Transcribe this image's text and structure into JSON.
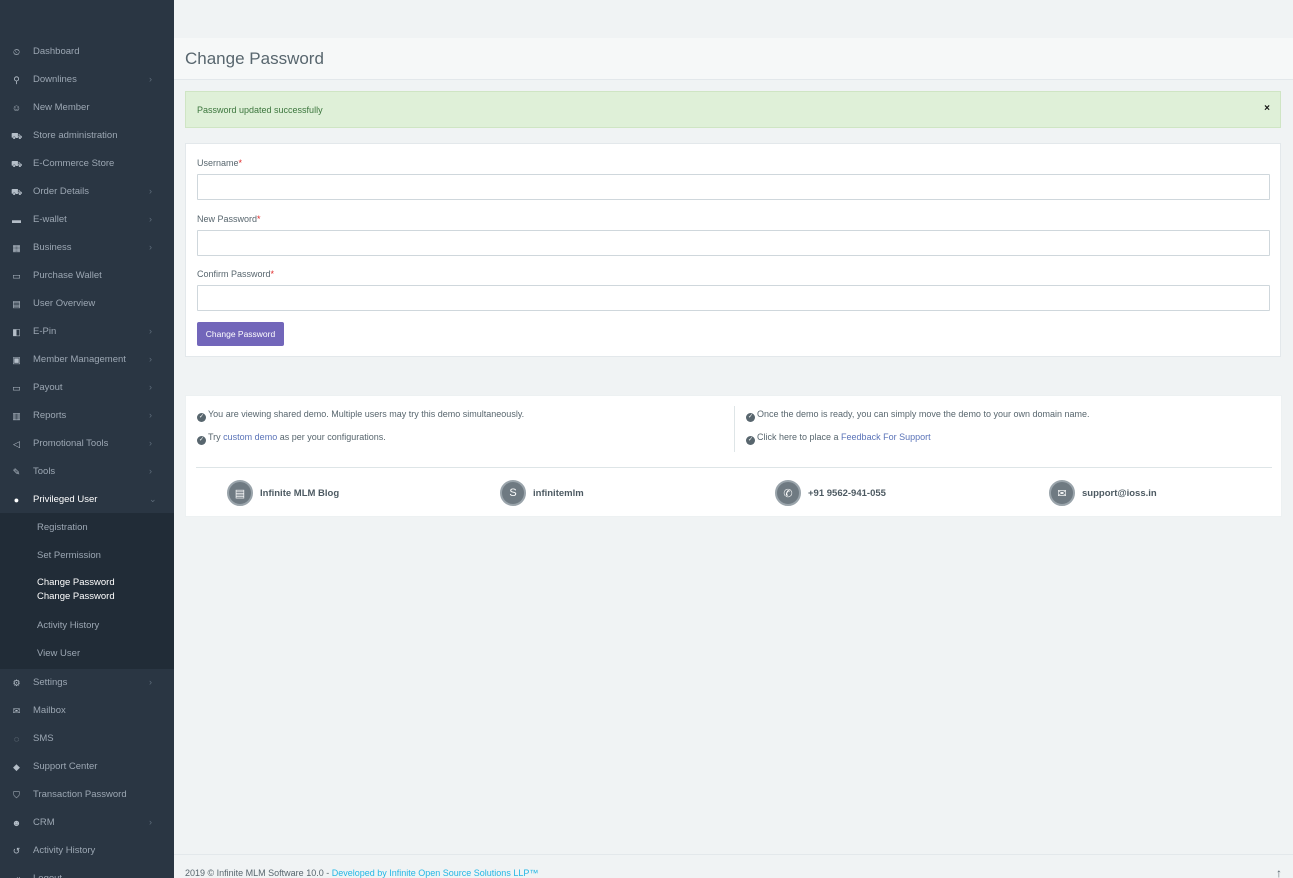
{
  "sidebar": {
    "items": [
      {
        "label": "Dashboard",
        "icon": "dashboard-icon",
        "glyph": "⏲",
        "chevron": false
      },
      {
        "label": "Downlines",
        "icon": "sitemap-icon",
        "glyph": "⚲",
        "chevron": true
      },
      {
        "label": "New Member",
        "icon": "user-plus-icon",
        "glyph": "☺",
        "chevron": false
      },
      {
        "label": "Store administration",
        "icon": "cart-arrow-icon",
        "glyph": "⛟",
        "chevron": false
      },
      {
        "label": "E-Commerce Store",
        "icon": "shopping-cart-icon",
        "glyph": "⛟",
        "chevron": false
      },
      {
        "label": "Order Details",
        "icon": "shopping-cart-icon",
        "glyph": "⛟",
        "chevron": true
      },
      {
        "label": "E-wallet",
        "icon": "briefcase-icon",
        "glyph": "▬",
        "chevron": true
      },
      {
        "label": "Business",
        "icon": "building-icon",
        "glyph": "▦",
        "chevron": true
      },
      {
        "label": "Purchase Wallet",
        "icon": "wallet-icon",
        "glyph": "▭",
        "chevron": false
      },
      {
        "label": "User Overview",
        "icon": "id-card-icon",
        "glyph": "▤",
        "chevron": false
      },
      {
        "label": "E-Pin",
        "icon": "bookmark-icon",
        "glyph": "◧",
        "chevron": true
      },
      {
        "label": "Member Management",
        "icon": "user-square-icon",
        "glyph": "▣",
        "chevron": true
      },
      {
        "label": "Payout",
        "icon": "money-icon",
        "glyph": "▭",
        "chevron": true
      },
      {
        "label": "Reports",
        "icon": "bar-chart-icon",
        "glyph": "▥",
        "chevron": true
      },
      {
        "label": "Promotional Tools",
        "icon": "bullhorn-icon",
        "glyph": "◁",
        "chevron": true
      },
      {
        "label": "Tools",
        "icon": "wrench-icon",
        "glyph": "✎",
        "chevron": true
      },
      {
        "label": "Privileged User",
        "icon": "user-circle-icon",
        "glyph": "●",
        "chevron": true,
        "active": true
      }
    ],
    "submenu": [
      {
        "label": "Registration"
      },
      {
        "label": "Set Permission"
      },
      {
        "label": "Change Password",
        "label2": "Change Password",
        "current": true
      },
      {
        "label": "Activity History"
      },
      {
        "label": "View User"
      }
    ],
    "items_after": [
      {
        "label": "Settings",
        "icon": "cogs-icon",
        "glyph": "⚙",
        "chevron": true
      },
      {
        "label": "Mailbox",
        "icon": "envelope-icon",
        "glyph": "✉",
        "chevron": false
      },
      {
        "label": "SMS",
        "icon": "comments-icon",
        "glyph": "◌",
        "chevron": false
      },
      {
        "label": "Support Center",
        "icon": "ticket-icon",
        "glyph": "◆",
        "chevron": false
      },
      {
        "label": "Transaction Password",
        "icon": "shield-icon",
        "glyph": "⛉",
        "chevron": false
      },
      {
        "label": "CRM",
        "icon": "users-icon",
        "glyph": "☻",
        "chevron": true
      },
      {
        "label": "Activity History",
        "icon": "history-icon",
        "glyph": "↺",
        "chevron": false
      },
      {
        "label": "Logout",
        "icon": "sign-out-icon",
        "glyph": "⇥",
        "chevron": false
      }
    ]
  },
  "page": {
    "title": "Change Password"
  },
  "alert": {
    "message": "Password updated successfully",
    "close": "×"
  },
  "form": {
    "username_label": "Username",
    "new_password_label": "New Password",
    "confirm_password_label": "Confirm Password",
    "required_mark": "*",
    "username_value": "",
    "new_password_value": "",
    "confirm_password_value": "",
    "submit_label": "Change Password"
  },
  "info": {
    "line1": "You are viewing shared demo. Multiple users may try this demo simultaneously.",
    "line2_pre": "Try ",
    "line2_link": "custom demo",
    "line2_post": " as per your configurations.",
    "line3": "Once the demo is ready, you can simply move the demo to your own domain name.",
    "line4_pre": "Click here to place a ",
    "line4_link": "Feedback For Support",
    "contacts": [
      {
        "label": "Infinite MLM Blog",
        "icon": "newspaper-icon",
        "glyph": "▤"
      },
      {
        "label": "infinitemlm",
        "icon": "skype-icon",
        "glyph": "S"
      },
      {
        "label": "+91 9562-941-055",
        "icon": "whatsapp-icon",
        "glyph": "✆"
      },
      {
        "label": "support@ioss.in",
        "icon": "envelope-icon",
        "glyph": "✉"
      }
    ]
  },
  "footer": {
    "text": "2019 © Infinite MLM Software 10.0 - ",
    "link": "Developed by Infinite Open Source Solutions LLP™",
    "scroll_top": "↑"
  }
}
